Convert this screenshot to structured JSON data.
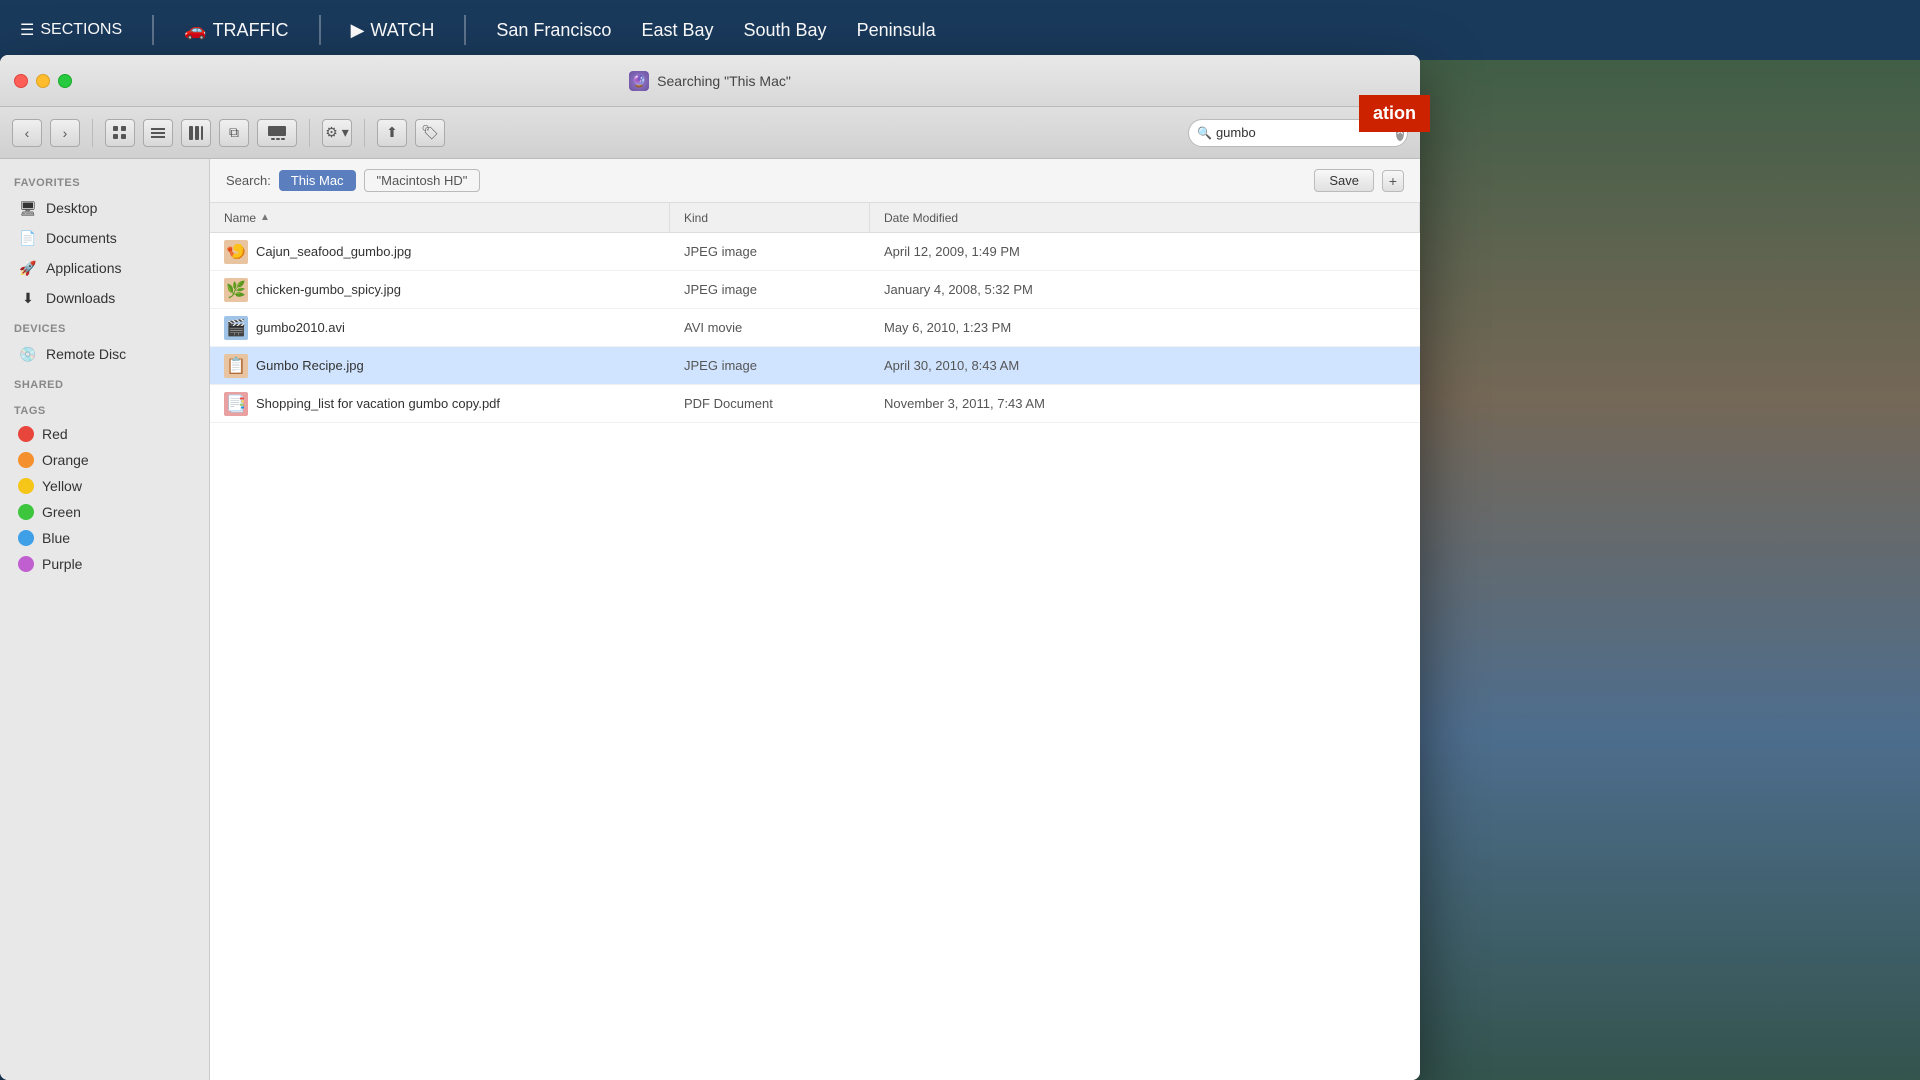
{
  "newsbar": {
    "sections_label": "SECTIONS",
    "traffic_label": "TRAFFIC",
    "watch_label": "WATCH",
    "locations": [
      "San Francisco",
      "East Bay",
      "South Bay",
      "Peninsula"
    ],
    "breaking_text": "ation"
  },
  "window": {
    "title": "Searching \"This Mac\"",
    "title_icon": "🔮"
  },
  "toolbar": {
    "back_label": "‹",
    "forward_label": "›",
    "view_icon_grid": "⊞",
    "view_icon_list": "≡",
    "view_icon_col": "⊟",
    "view_icon_cov": "⧉",
    "view_icon_gallery": "⊡",
    "action_label": "⚙",
    "share_label": "⬆",
    "tag_label": "🏷",
    "search_placeholder": "gumbo",
    "search_value": "gumbo"
  },
  "search_bar": {
    "label": "Search:",
    "scope_this_mac": "This Mac",
    "scope_macintosh_hd": "\"Macintosh HD\"",
    "save_label": "Save",
    "plus_label": "+"
  },
  "columns": {
    "name": "Name",
    "kind": "Kind",
    "date": "Date Modified",
    "sort_arrow": "▲"
  },
  "sidebar": {
    "favorites_label": "Favorites",
    "items": [
      {
        "id": "desktop",
        "label": "Desktop",
        "icon": "🖥"
      },
      {
        "id": "documents",
        "label": "Documents",
        "icon": "📄"
      },
      {
        "id": "applications",
        "label": "Applications",
        "icon": "🚀"
      },
      {
        "id": "downloads",
        "label": "Downloads",
        "icon": "⬇"
      }
    ],
    "devices_label": "Devices",
    "devices": [
      {
        "id": "remote-disc",
        "label": "Remote Disc",
        "icon": "💿"
      }
    ],
    "shared_label": "Shared",
    "tags_label": "Tags",
    "tags": [
      {
        "id": "red",
        "label": "Red",
        "color": "#e8453c"
      },
      {
        "id": "orange",
        "label": "Orange",
        "color": "#f5902e"
      },
      {
        "id": "yellow",
        "label": "Yellow",
        "color": "#f5c518"
      },
      {
        "id": "green",
        "label": "Green",
        "color": "#3dc53d"
      },
      {
        "id": "blue",
        "label": "Blue",
        "color": "#3fa0e8"
      },
      {
        "id": "purple",
        "label": "Purple",
        "color": "#c060d0"
      }
    ]
  },
  "files": [
    {
      "id": "file1",
      "name": "Cajun_seafood_gumbo.jpg",
      "kind": "JPEG image",
      "date": "April 12, 2009, 1:49 PM",
      "thumb_type": "jpg",
      "selected": false
    },
    {
      "id": "file2",
      "name": "chicken-gumbo_spicy.jpg",
      "kind": "JPEG image",
      "date": "January 4, 2008, 5:32 PM",
      "thumb_type": "jpg",
      "selected": false
    },
    {
      "id": "file3",
      "name": "gumbo2010.avi",
      "kind": "AVI movie",
      "date": "May 6, 2010, 1:23 PM",
      "thumb_type": "avi",
      "selected": false
    },
    {
      "id": "file4",
      "name": "Gumbo Recipe.jpg",
      "kind": "JPEG image",
      "date": "April 30, 2010, 8:43 AM",
      "thumb_type": "jpg",
      "selected": true
    },
    {
      "id": "file5",
      "name": "Shopping_list for vacation gumbo copy.pdf",
      "kind": "PDF Document",
      "date": "November 3, 2011, 7:43 AM",
      "thumb_type": "pdf",
      "selected": false
    }
  ]
}
